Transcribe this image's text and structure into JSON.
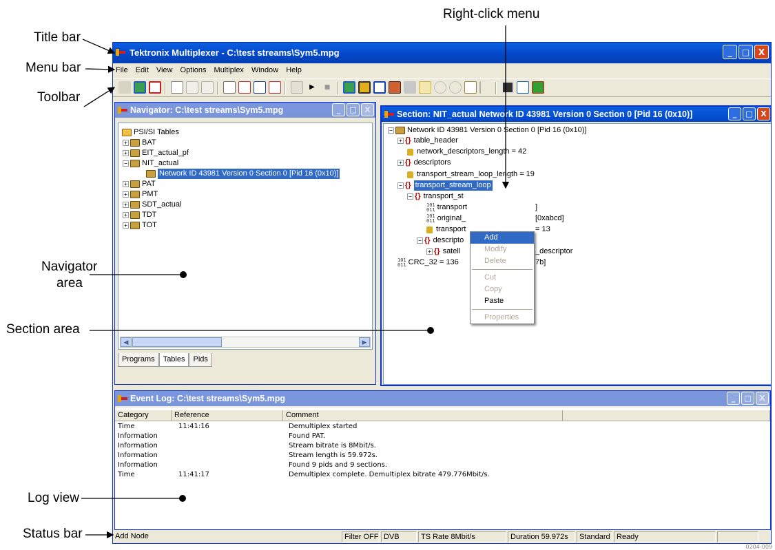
{
  "callouts": {
    "title_bar": "Title bar",
    "menu_bar": "Menu bar",
    "toolbar": "Toolbar",
    "navigator_area_1": "Navigator",
    "navigator_area_2": "area",
    "section_area": "Section area",
    "log_view": "Log view",
    "status_bar": "Status bar",
    "right_click_menu": "Right-click menu"
  },
  "window": {
    "title": "Tektronix Multiplexer - C:\\test streams\\Sym5.mpg",
    "controls": [
      "_",
      "□",
      "X"
    ]
  },
  "menu": [
    "File",
    "Edit",
    "View",
    "Options",
    "Multiplex",
    "Window",
    "Help"
  ],
  "toolbar_icons": [
    "open-icon",
    "sections-icon",
    "stop-icon",
    "new-section-icon",
    "edit-icon",
    "copy-icon",
    "binary-icon",
    "filter-icon",
    "table-icon",
    "pid-icon",
    "properties-icon",
    "play-icon",
    "stop-square-icon",
    "connect-icon",
    "find-icon",
    "window-icon",
    "grid-icon",
    "multiplex-icon",
    "lock-icon",
    "zoom-in-icon",
    "zoom-out-icon",
    "bitrate-icon",
    "cursor-icon",
    "display-icon",
    "print-icon",
    "check-icon"
  ],
  "navigator": {
    "title": "Navigator: C:\\test streams\\Sym5.mpg",
    "root": "PSI/SI Tables",
    "items": [
      "BAT",
      "EIT_actual_pf",
      "NIT_actual",
      "PAT",
      "PMT",
      "SDT_actual",
      "TDT",
      "TOT"
    ],
    "selected_child": "Network ID 43981 Version   0 Section   0 [Pid 16 (0x10)]",
    "tabs": [
      "Programs",
      "Tables",
      "Pids"
    ],
    "active_tab": "Tables"
  },
  "section": {
    "title": "Section: NIT_actual Network ID 43981 Version   0 Section   0 [Pid 16 (0x10)]",
    "rows": {
      "root": "Network ID 43981 Version   0 Section   0 [Pid 16 (0x10)]",
      "table_header": "table_header",
      "network_descriptors_length": "network_descriptors_length = 42",
      "descriptors": "descriptors",
      "transport_stream_loop_length": "transport_stream_loop_length = 19",
      "transport_stream_loop": "transport_stream_loop",
      "transport_st": "transport_st",
      "transport_id": "transport",
      "transport_id_tail": "]",
      "original": "original_",
      "original_tail": "[0xabcd]",
      "transport_len": "transport",
      "transport_len_tail": "= 13",
      "descriptor": "descripto",
      "satell": "satell",
      "satell_tail": "_descriptor",
      "crc": "CRC_32 = 136",
      "crc_tail": "7b]"
    }
  },
  "context_menu": {
    "items": [
      {
        "label": "Add",
        "state": "selected"
      },
      {
        "label": "Modify",
        "state": "disabled"
      },
      {
        "label": "Delete",
        "state": "disabled"
      },
      {
        "label": "Cut",
        "state": "disabled"
      },
      {
        "label": "Copy",
        "state": "disabled"
      },
      {
        "label": "Paste",
        "state": "enabled"
      },
      {
        "label": "Properties",
        "state": "disabled"
      }
    ]
  },
  "event_log": {
    "title": "Event Log: C:\\test streams\\Sym5.mpg",
    "columns": [
      "Category",
      "Reference",
      "Comment"
    ],
    "rows": [
      [
        "Time",
        "11:41:16",
        "Demultiplex started"
      ],
      [
        "Information",
        "",
        "Found PAT."
      ],
      [
        "Information",
        "",
        "Stream bitrate is 8Mbit/s."
      ],
      [
        "Information",
        "",
        "Stream length is 59.972s."
      ],
      [
        "Information",
        "",
        "Found 9 pids and 9 sections."
      ],
      [
        "Time",
        "11:41:17",
        "Demultiplex complete.  Demultiplex bitrate 479.776Mbit/s."
      ]
    ]
  },
  "status_bar": {
    "message": "Add Node",
    "filter": "Filter OFF",
    "standard_type": "DVB",
    "ts_rate": "TS Rate 8Mbit/s",
    "duration": "Duration 59.972s",
    "standard": "Standard",
    "state": "Ready"
  },
  "figure_id": "0204-009"
}
